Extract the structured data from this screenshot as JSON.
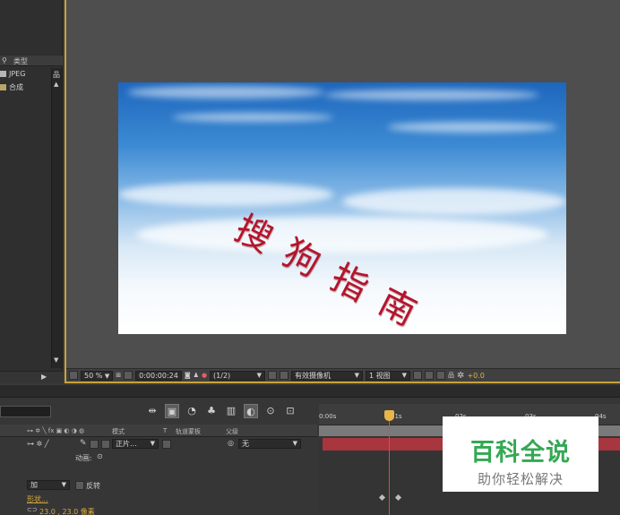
{
  "project_panel": {
    "type_header": "类型",
    "items": [
      {
        "type": "JPEG",
        "swatch": "#b5b5b5"
      },
      {
        "type": "合成",
        "swatch": "#b9a56a"
      }
    ]
  },
  "viewer": {
    "canvas_text": "搜狗指南",
    "zoom": "50 %",
    "timecode": "0:00:00:24",
    "resolution": "(1/2)",
    "camera": "有效摄像机",
    "views": "1 视图",
    "exposure": "+0.0"
  },
  "timeline": {
    "columns": {
      "mode": "模式",
      "t": "T",
      "trkmat": "轨道蒙板",
      "parent": "父级"
    },
    "layer": {
      "mode_value": "正片...",
      "parent_value": "无"
    },
    "props": {
      "animate": "动画:",
      "blend_mode": "加",
      "invert": "反转",
      "path": "形状...",
      "values": "23.0 , 23.0 像素"
    },
    "ruler_ticks": [
      "0:00s",
      "01s",
      "02s",
      "03s",
      "04s"
    ]
  },
  "watermark": {
    "title": "百科全说",
    "subtitle": "助你轻松解决"
  },
  "colors": {
    "accent": "#c9a33a",
    "layer_bar": "#a8363f",
    "cti": "#e24a3a",
    "watermark_green": "#34a853"
  }
}
